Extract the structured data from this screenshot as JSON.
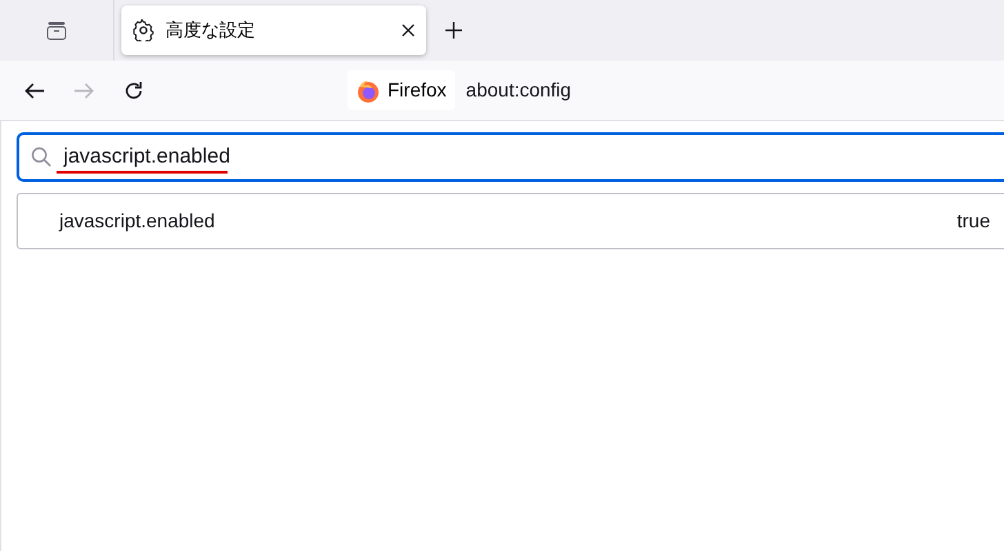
{
  "tabs": [
    {
      "label": "高度な設定",
      "selected": true
    }
  ],
  "nav_buttons": [
    {
      "kind": "back",
      "disabled": false
    },
    {
      "kind": "forward",
      "disabled": true
    },
    {
      "kind": "reload",
      "disabled": false
    }
  ],
  "address_bar": {
    "identity": "Firefox",
    "url": "about:config"
  },
  "search": {
    "value": "javascript.enabled"
  },
  "preferences": [
    {
      "name": "javascript.enabled",
      "value": "true"
    }
  ]
}
